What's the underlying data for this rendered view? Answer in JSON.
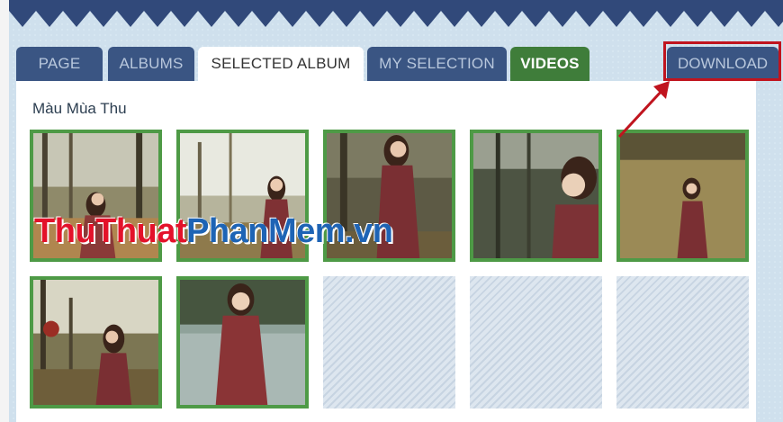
{
  "tabs": [
    {
      "label": "PAGE",
      "state": "inactive"
    },
    {
      "label": "ALBUMS",
      "state": "inactive"
    },
    {
      "label": "SELECTED ALBUM",
      "state": "active"
    },
    {
      "label": "MY SELECTION",
      "state": "inactive"
    },
    {
      "label": "VIDEOS",
      "state": "inactive"
    }
  ],
  "download_label": "DOWNLOAD",
  "album_title": "Màu Mùa Thu",
  "watermark": {
    "part1": "ThuThuat",
    "part2": "PhanMem",
    "part3": ".vn"
  },
  "photos": [
    {
      "scene": "forest-path"
    },
    {
      "scene": "forest-light"
    },
    {
      "scene": "forest-dark"
    },
    {
      "scene": "forest-closeup"
    },
    {
      "scene": "field"
    },
    {
      "scene": "forest-backlight"
    },
    {
      "scene": "lake"
    }
  ],
  "empty_slots": 3,
  "colors": {
    "tab_bg": "#3a5583",
    "tab_text": "#b8c7dc",
    "videos_bg": "#3f7d3a",
    "photo_border": "#4e9a46",
    "highlight": "#c0141e"
  }
}
